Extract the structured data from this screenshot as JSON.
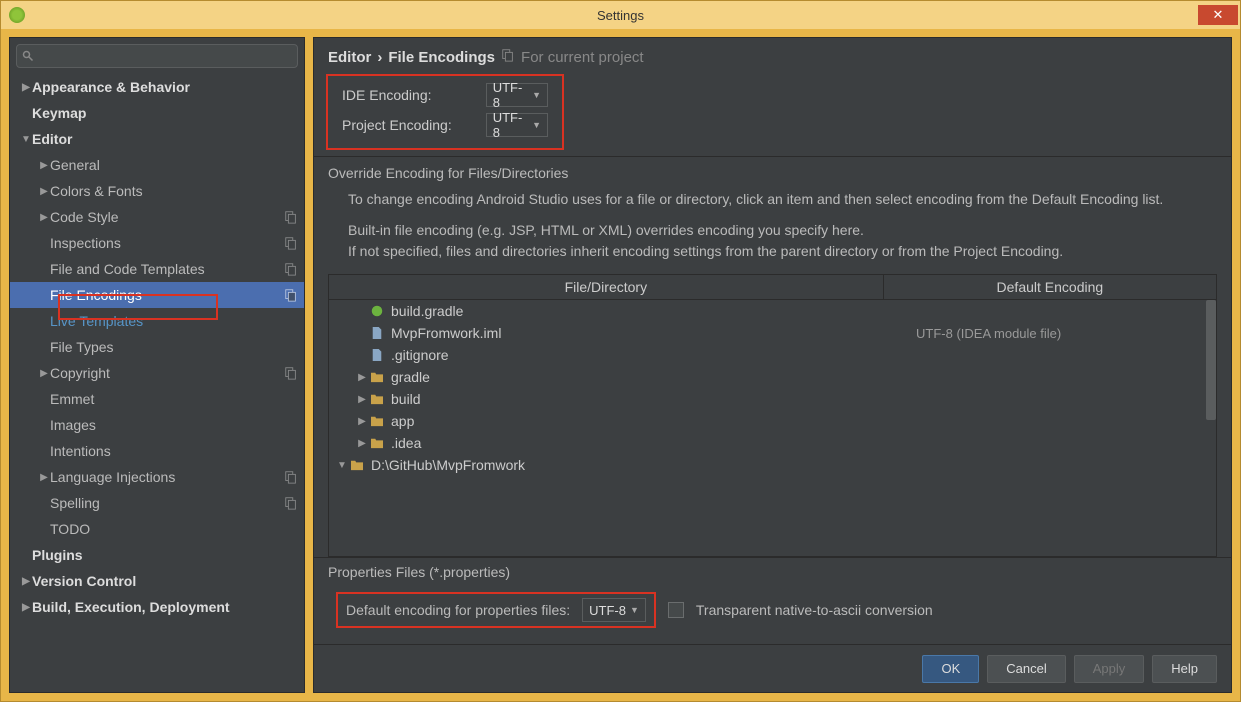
{
  "window": {
    "title": "Settings"
  },
  "sidebar": {
    "search_placeholder": "",
    "items": [
      {
        "label": "Appearance & Behavior",
        "depth": 0,
        "arrow": "▶",
        "bold": true
      },
      {
        "label": "Keymap",
        "depth": 0,
        "arrow": "",
        "bold": true
      },
      {
        "label": "Editor",
        "depth": 0,
        "arrow": "▼",
        "bold": true
      },
      {
        "label": "General",
        "depth": 1,
        "arrow": "▶"
      },
      {
        "label": "Colors & Fonts",
        "depth": 1,
        "arrow": "▶"
      },
      {
        "label": "Code Style",
        "depth": 1,
        "arrow": "▶",
        "copy": true
      },
      {
        "label": "Inspections",
        "depth": 1,
        "arrow": "",
        "copy": true
      },
      {
        "label": "File and Code Templates",
        "depth": 1,
        "arrow": "",
        "copy": true
      },
      {
        "label": "File Encodings",
        "depth": 1,
        "arrow": "",
        "copy": true,
        "selected": true,
        "modified": true
      },
      {
        "label": "Live Templates",
        "depth": 1,
        "arrow": "",
        "modified": true
      },
      {
        "label": "File Types",
        "depth": 1,
        "arrow": ""
      },
      {
        "label": "Copyright",
        "depth": 1,
        "arrow": "▶",
        "copy": true
      },
      {
        "label": "Emmet",
        "depth": 1,
        "arrow": ""
      },
      {
        "label": "Images",
        "depth": 1,
        "arrow": ""
      },
      {
        "label": "Intentions",
        "depth": 1,
        "arrow": ""
      },
      {
        "label": "Language Injections",
        "depth": 1,
        "arrow": "▶",
        "copy": true
      },
      {
        "label": "Spelling",
        "depth": 1,
        "arrow": "",
        "copy": true
      },
      {
        "label": "TODO",
        "depth": 1,
        "arrow": ""
      },
      {
        "label": "Plugins",
        "depth": 0,
        "arrow": "",
        "bold": true
      },
      {
        "label": "Version Control",
        "depth": 0,
        "arrow": "▶",
        "bold": true
      },
      {
        "label": "Build, Execution, Deployment",
        "depth": 0,
        "arrow": "▶",
        "bold": true
      }
    ]
  },
  "breadcrumb": {
    "parent": "Editor",
    "sep": "›",
    "current": "File Encodings",
    "scope": "For current project"
  },
  "fields": {
    "ide_label": "IDE Encoding:",
    "ide_value": "UTF-8",
    "project_label": "Project Encoding:",
    "project_value": "UTF-8"
  },
  "override": {
    "title": "Override Encoding for Files/Directories",
    "p1": "To change encoding Android Studio uses for a file or directory, click an item and then select encoding from the Default Encoding list.",
    "p2a": "Built-in file encoding (e.g. JSP, HTML or XML) overrides encoding you specify here.",
    "p2b": "If not specified, files and directories inherit encoding settings from the parent directory or from the Project Encoding."
  },
  "table": {
    "col1": "File/Directory",
    "col2": "Default Encoding",
    "rows": [
      {
        "label": "D:\\GitHub\\MvpFromwork",
        "depth": 0,
        "arrow": "▼",
        "icon": "folder"
      },
      {
        "label": ".idea",
        "depth": 1,
        "arrow": "▶",
        "icon": "folder"
      },
      {
        "label": "app",
        "depth": 1,
        "arrow": "▶",
        "icon": "folder"
      },
      {
        "label": "build",
        "depth": 1,
        "arrow": "▶",
        "icon": "folder"
      },
      {
        "label": "gradle",
        "depth": 1,
        "arrow": "▶",
        "icon": "folder"
      },
      {
        "label": ".gitignore",
        "depth": 1,
        "arrow": "",
        "icon": "file"
      },
      {
        "label": "MvpFromwork.iml",
        "depth": 1,
        "arrow": "",
        "icon": "file",
        "enc": "UTF-8 (IDEA module file)"
      },
      {
        "label": "build.gradle",
        "depth": 1,
        "arrow": "",
        "icon": "green"
      }
    ]
  },
  "props": {
    "title": "Properties Files (*.properties)",
    "label": "Default encoding for properties files:",
    "value": "UTF-8",
    "checkbox_label": "Transparent native-to-ascii conversion"
  },
  "buttons": {
    "ok": "OK",
    "cancel": "Cancel",
    "apply": "Apply",
    "help": "Help"
  }
}
